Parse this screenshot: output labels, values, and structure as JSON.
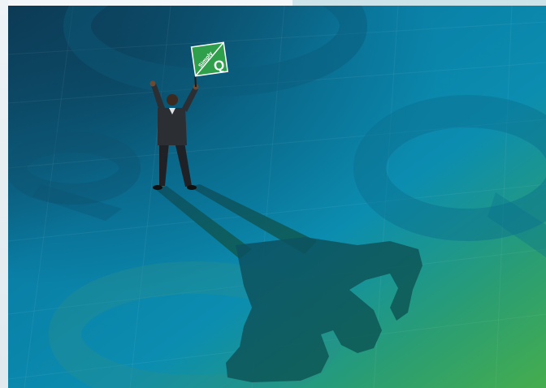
{
  "artwork": {
    "flag": {
      "text_line_1": "Simply",
      "text_line_2": "Q"
    },
    "colors": {
      "bg_top_left": "#0f4a63",
      "bg_mid": "#0a8fb4",
      "bg_bottom_right": "#3aa85a",
      "flag_green": "#2f9f4c",
      "suit": "#2b2f34",
      "shadow": "#0c5a57"
    }
  }
}
